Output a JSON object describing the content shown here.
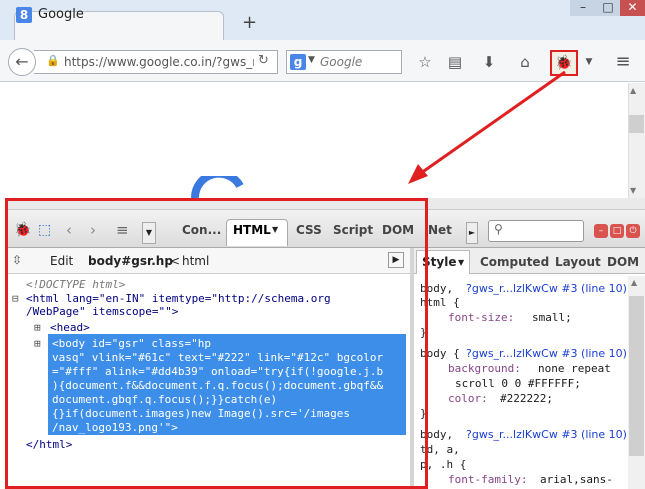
{
  "browser": {
    "tab_title": "Google",
    "new_tab": "+",
    "url": "https://www.google.co.in/?gws_r",
    "search_placeholder": "Google",
    "window_controls": {
      "min": "–",
      "max": "□",
      "close": "✕"
    }
  },
  "toolbar_icons": [
    "back-arrow-icon",
    "lock-icon",
    "reload-icon",
    "star-icon",
    "clipboard-icon",
    "download-icon",
    "home-icon",
    "firebug-icon",
    "menu-icon"
  ],
  "firebug": {
    "tabs": [
      "Con...",
      "HTML",
      "CSS",
      "Script",
      "DOM",
      "Net"
    ],
    "active_tab": "HTML",
    "crumbs": {
      "edit": "Edit",
      "current": "body#gsr.hp",
      "sep": "<",
      "parent": "html"
    },
    "side_tabs": [
      "Style",
      "Computed",
      "Layout",
      "DOM"
    ],
    "html_lines": [
      "<!DOCTYPE html>",
      "<html lang=\"en-IN\" itemtype=\"http://schema.org",
      "/WebPage\" itemscope=\"\">",
      "<head>",
      "<body id=\"gsr\" class=\"hp",
      "vasq\" vlink=\"#61c\" text=\"#222\" link=\"#12c\" bgcolor",
      "=\"#fff\" alink=\"#dd4b39\" onload=\"try{if(!google.j.b",
      "){document.f&&document.f.q.focus();document.gbqf&&",
      "document.gbqf.q.focus();}}catch(e)",
      "{}if(document.images)new Image().src='/images",
      "/nav_logo193.png'\">",
      "</html>"
    ],
    "css_rules": [
      {
        "selector": "body,",
        "link": "?gws_r...lzlKwCw #3 (line 10)"
      },
      {
        "selector": "html {"
      },
      {
        "prop": "font-size:",
        "value": "small;"
      },
      {
        "selector": "}"
      },
      {
        "selector": "body {",
        "link": "?gws_r...lzlKwCw #3 (line 10)"
      },
      {
        "prop": "background:",
        "value": "none repeat"
      },
      {
        "value": "scroll 0 0 #FFFFFF;"
      },
      {
        "prop": "color:",
        "value": "#222222;"
      },
      {
        "selector": "}"
      },
      {
        "selector": "body,",
        "link": "?gws_r...lzlKwCw #3 (line 10)"
      },
      {
        "selector": "td, a,"
      },
      {
        "selector": "p, .h {"
      },
      {
        "prop": "font-family:",
        "value": "arial,sans-"
      }
    ]
  }
}
